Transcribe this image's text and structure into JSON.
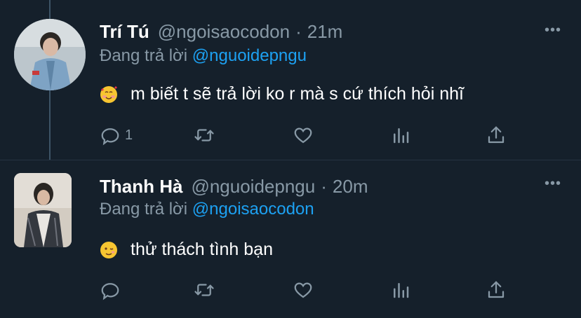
{
  "tweets": [
    {
      "name": "Trí Tú",
      "handle": "@ngoisaocodon",
      "separator": "·",
      "time": "21m",
      "reply_prefix": "Đang trả lời",
      "reply_to": "@nguoidepngu",
      "text": "m biết t sẽ trả lời ko r mà s cứ thích hỏi nhĩ",
      "emoji": "smiling-face-with-hearts-emoji",
      "reply_count": "1",
      "more": "•••"
    },
    {
      "name": "Thanh Hà",
      "handle": "@nguoidepngu",
      "separator": "·",
      "time": "20m",
      "reply_prefix": "Đang trả lời",
      "reply_to": "@ngoisaocodon",
      "text": "thử thách tình bạn",
      "emoji": "winking-face-emoji",
      "reply_count": "",
      "more": "•••"
    }
  ],
  "colors": {
    "background": "#15202b",
    "secondary_text": "#8899a6",
    "link": "#1da1f2",
    "thread_line": "#3d5466"
  }
}
